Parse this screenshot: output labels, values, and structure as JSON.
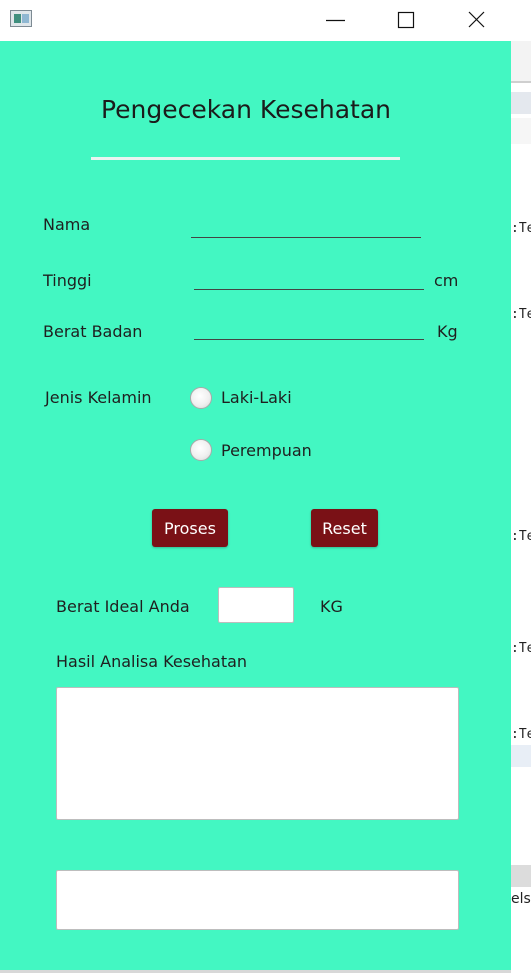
{
  "window": {
    "controls": [
      "minimize-icon",
      "maximize-icon",
      "close-icon"
    ]
  },
  "form": {
    "title": "Pengecekan Kesehatan",
    "fields": {
      "nama_label": "Nama",
      "nama_value": "",
      "tinggi_label": "Tinggi",
      "tinggi_value": "",
      "tinggi_unit": "cm",
      "berat_label": "Berat Badan",
      "berat_value": "",
      "berat_unit": "Kg"
    },
    "gender": {
      "label": "Jenis Kelamin",
      "options": [
        "Laki-Laki",
        "Perempuan"
      ],
      "selected": null
    },
    "buttons": {
      "proses": "Proses",
      "reset": "Reset"
    },
    "result": {
      "ideal_label": "Berat Ideal Anda",
      "ideal_value": "",
      "ideal_unit": "KG",
      "analysis_label": "Hasil Analisa Kesehatan",
      "analysis_value": "",
      "extra_value": ""
    }
  },
  "background_editor": {
    "snippets": [
      ":Te",
      ":Te",
      ":Te",
      ":Te",
      ":Te",
      "els"
    ]
  },
  "colors": {
    "form_background": "#43f7c2",
    "button_background": "#7a1116",
    "button_text": "#ffffff"
  }
}
